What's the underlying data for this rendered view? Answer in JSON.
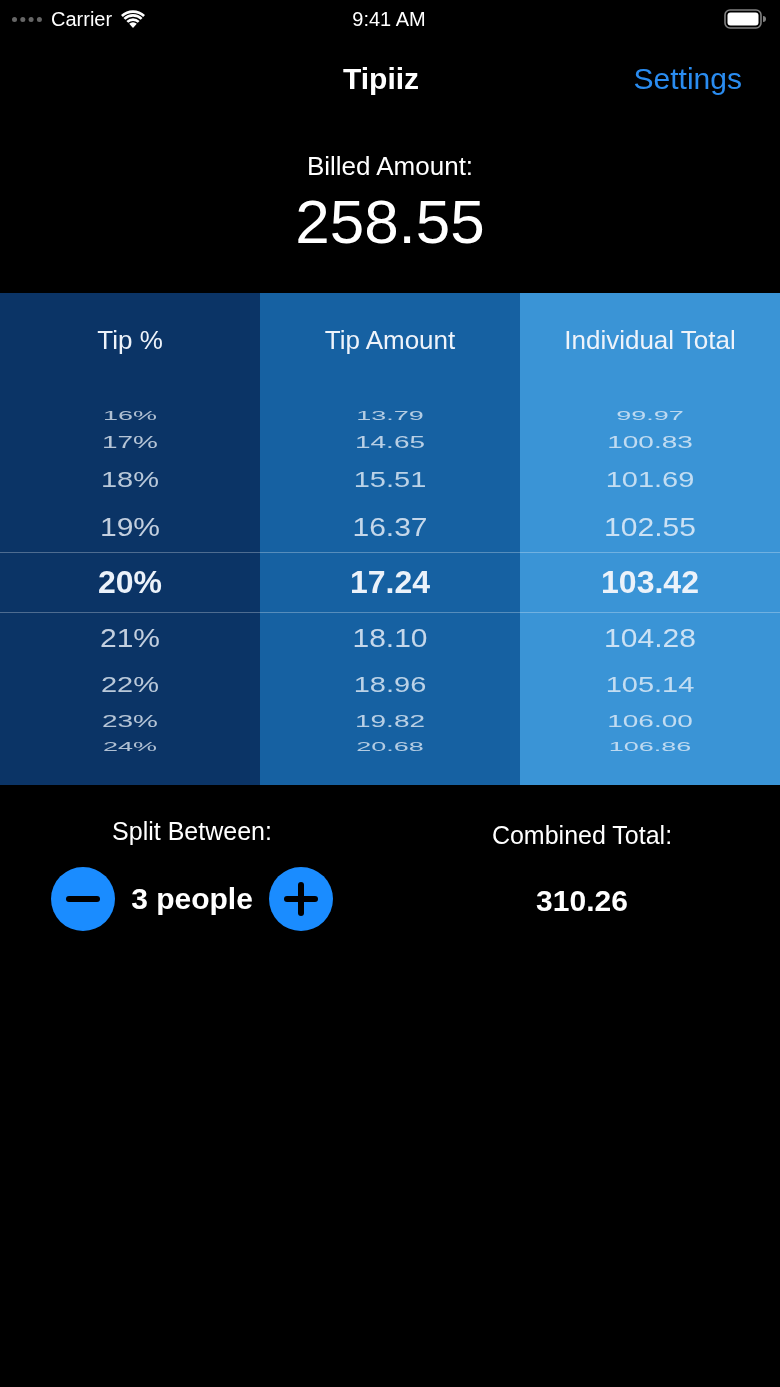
{
  "status_bar": {
    "carrier": "Carrier",
    "time": "9:41 AM"
  },
  "nav_bar": {
    "title": "Tipiiz",
    "settings_link": "Settings"
  },
  "bill": {
    "label": "Billed Amount:",
    "amount": "258.55"
  },
  "picker": {
    "columns": [
      {
        "header": "Tip %",
        "color": "#0b3466",
        "rows": [
          {
            "value": "16%",
            "selected": false
          },
          {
            "value": "17%",
            "selected": false
          },
          {
            "value": "18%",
            "selected": false
          },
          {
            "value": "19%",
            "selected": false
          },
          {
            "value": "20%",
            "selected": true
          },
          {
            "value": "21%",
            "selected": false
          },
          {
            "value": "22%",
            "selected": false
          },
          {
            "value": "23%",
            "selected": false
          },
          {
            "value": "24%",
            "selected": false
          }
        ]
      },
      {
        "header": "Tip Amount",
        "color": "#1661a2",
        "rows": [
          {
            "value": "13.79",
            "selected": false
          },
          {
            "value": "14.65",
            "selected": false
          },
          {
            "value": "15.51",
            "selected": false
          },
          {
            "value": "16.37",
            "selected": false
          },
          {
            "value": "17.24",
            "selected": true
          },
          {
            "value": "18.10",
            "selected": false
          },
          {
            "value": "18.96",
            "selected": false
          },
          {
            "value": "19.82",
            "selected": false
          },
          {
            "value": "20.68",
            "selected": false
          }
        ]
      },
      {
        "header": "Individual Total",
        "color": "#3a94d6",
        "rows": [
          {
            "value": "99.97",
            "selected": false
          },
          {
            "value": "100.83",
            "selected": false
          },
          {
            "value": "101.69",
            "selected": false
          },
          {
            "value": "102.55",
            "selected": false
          },
          {
            "value": "103.42",
            "selected": true
          },
          {
            "value": "104.28",
            "selected": false
          },
          {
            "value": "105.14",
            "selected": false
          },
          {
            "value": "106.00",
            "selected": false
          },
          {
            "value": "106.86",
            "selected": false
          }
        ]
      }
    ]
  },
  "split": {
    "label": "Split Between:",
    "count": "3 people"
  },
  "combined": {
    "label": "Combined Total:",
    "amount": "310.26"
  }
}
